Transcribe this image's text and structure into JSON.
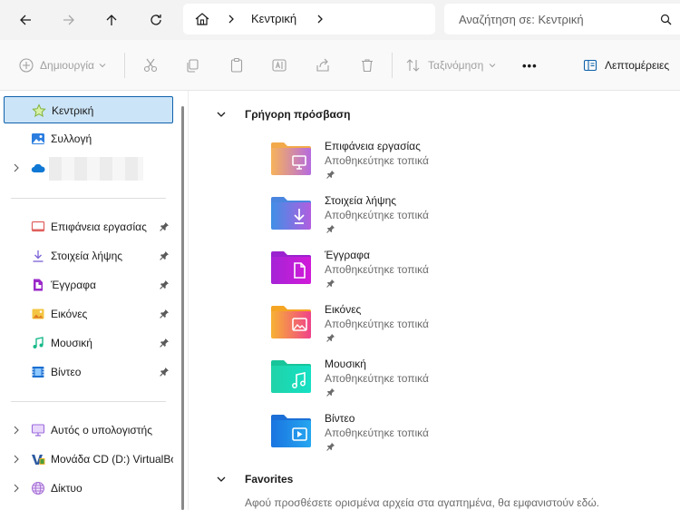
{
  "address": {
    "crumb": "Κεντρική"
  },
  "search": {
    "placeholder": "Αναζήτηση σε: Κεντρική"
  },
  "commands": {
    "create": "Δημιουργία",
    "sort": "Ταξινόμηση",
    "more": "•••",
    "details": "Λεπτομέρειες"
  },
  "sidebar": {
    "items": [
      {
        "label": "Κεντρική",
        "icon": "home-star-icon"
      },
      {
        "label": "Συλλογή",
        "icon": "gallery-icon"
      },
      {
        "label": "",
        "icon": "onedrive-cloud-icon"
      }
    ],
    "pinned": [
      {
        "label": "Επιφάνεια εργασίας",
        "icon": "desktop-icon"
      },
      {
        "label": "Στοιχεία λήψης",
        "icon": "download-icon"
      },
      {
        "label": "Έγγραφα",
        "icon": "document-icon"
      },
      {
        "label": "Εικόνες",
        "icon": "pictures-icon"
      },
      {
        "label": "Μουσική",
        "icon": "music-icon"
      },
      {
        "label": "Βίντεο",
        "icon": "video-icon"
      }
    ],
    "devices": [
      {
        "label": "Αυτός ο υπολογιστής",
        "icon": "computer-icon"
      },
      {
        "label": "Μονάδα CD (D:) VirtualBox",
        "icon": "cd-drive-icon"
      },
      {
        "label": "Δίκτυο",
        "icon": "network-icon"
      }
    ]
  },
  "main": {
    "quick_access_title": "Γρήγορη πρόσβαση",
    "folders": [
      {
        "name": "Επιφάνεια εργασίας",
        "sub": "Αποθηκεύτηκε τοπικά"
      },
      {
        "name": "Στοιχεία λήψης",
        "sub": "Αποθηκεύτηκε τοπικά"
      },
      {
        "name": "Έγγραφα",
        "sub": "Αποθηκεύτηκε τοπικά"
      },
      {
        "name": "Εικόνες",
        "sub": "Αποθηκεύτηκε τοπικά"
      },
      {
        "name": "Μουσική",
        "sub": "Αποθηκεύτηκε τοπικά"
      },
      {
        "name": "Βίντεο",
        "sub": "Αποθηκεύτηκε τοπικά"
      }
    ],
    "favorites_title": "Favorites",
    "favorites_text": "Αφού προσθέσετε ορισμένα αρχεία στα αγαπημένα, θα εμφανιστούν εδώ."
  },
  "colors": {
    "accent": "#0f62ac",
    "selection": "#cce4f7"
  }
}
